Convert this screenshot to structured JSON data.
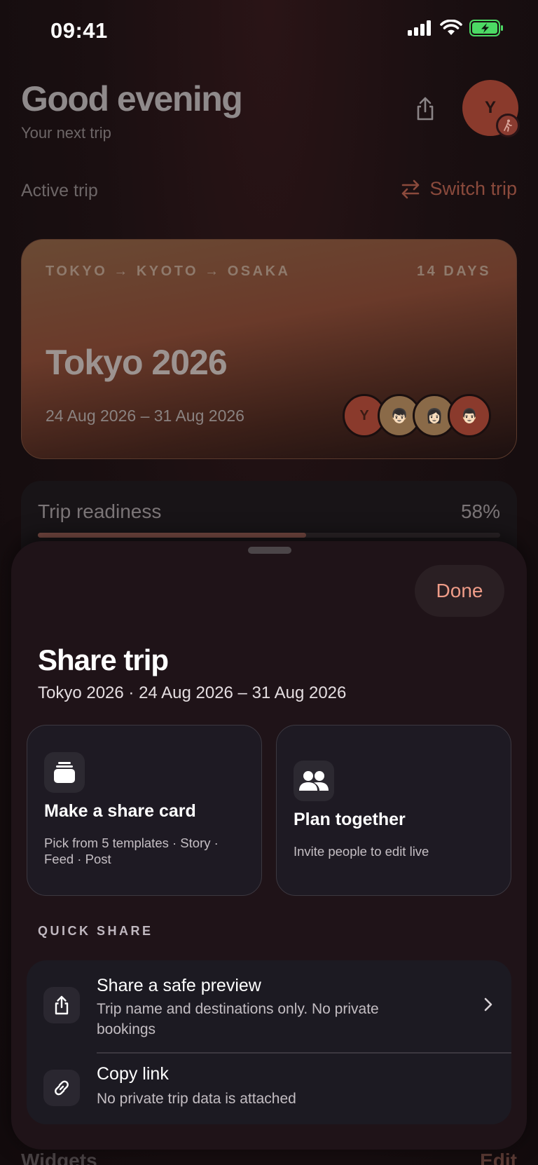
{
  "status_bar": {
    "time": "09:41"
  },
  "home": {
    "greeting": "Good evening",
    "greeting_sub": "Your next trip",
    "avatar_initial": "Y",
    "active_trip_label": "Active trip",
    "switch_trip_label": "Switch trip",
    "trip_card": {
      "route": "TOKYO → KYOTO → OSAKA",
      "days": "14 DAYS",
      "title": "Tokyo 2026",
      "dates": "24 Aug 2026 – 31 Aug 2026",
      "members": [
        "Y",
        "👦🏻",
        "👩🏻",
        "👨🏻"
      ]
    },
    "readiness": {
      "label": "Trip readiness",
      "percent_label": "58%",
      "value": 0.58
    },
    "widgets_label": "Widgets",
    "widgets_edit": "Edit"
  },
  "sheet": {
    "done_label": "Done",
    "title": "Share trip",
    "subtitle": "Tokyo 2026 · 24 Aug 2026 – 31 Aug 2026",
    "cards": [
      {
        "title": "Make a share card",
        "desc": "Pick from 5 templates · Story · Feed · Post",
        "icon": "stack-card-icon"
      },
      {
        "title": "Plan together",
        "desc": "Invite people to edit live",
        "icon": "people-icon"
      }
    ],
    "quick_share_label": "QUICK SHARE",
    "quick_share": [
      {
        "title": "Share a safe preview",
        "desc": "Trip name and destinations only. No private bookings",
        "icon": "share-icon"
      },
      {
        "title": "Copy link",
        "desc": "No private trip data is attached",
        "icon": "link-icon"
      }
    ]
  },
  "colors": {
    "accent": "#ef9c88",
    "sheet_bg": "#1f1318",
    "card_bg": "#1e1a23",
    "battery_green": "#4cd964"
  }
}
